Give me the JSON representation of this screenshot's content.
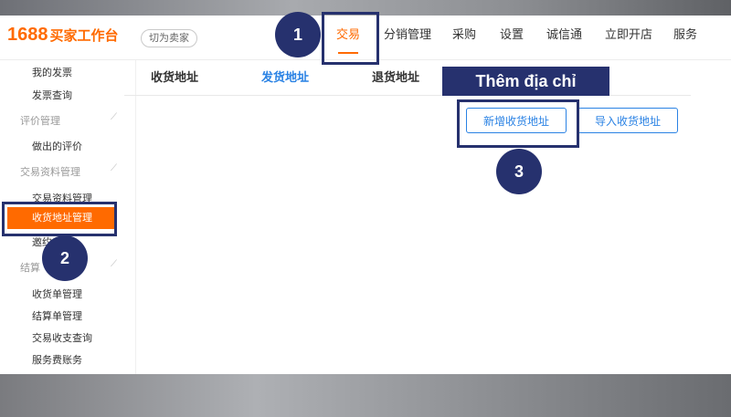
{
  "header": {
    "logo_number": "1688",
    "logo_text": "买家工作台",
    "switch_label": "切为卖家",
    "nav": [
      "交易",
      "分销管理",
      "采购",
      "设置",
      "诚信通",
      "立即开店",
      "服务"
    ],
    "active_nav_index": 0
  },
  "sidebar": {
    "items": [
      {
        "label": "我的发票",
        "type": "item"
      },
      {
        "label": "发票查询",
        "type": "item"
      },
      {
        "label": "评价管理",
        "type": "group"
      },
      {
        "label": "做出的评价",
        "type": "item"
      },
      {
        "label": "交易资料管理",
        "type": "group"
      },
      {
        "label": "交易资料管理",
        "type": "item"
      },
      {
        "label": "收货地址管理",
        "type": "active"
      },
      {
        "label": "邀约",
        "type": "item"
      },
      {
        "label": "结算",
        "type": "group"
      },
      {
        "label": "收货单管理",
        "type": "item"
      },
      {
        "label": "结算单管理",
        "type": "item"
      },
      {
        "label": "交易收支查询",
        "type": "item"
      },
      {
        "label": "服务费账务",
        "type": "item"
      }
    ]
  },
  "tabs": [
    {
      "label": "收货地址"
    },
    {
      "label": "发货地址"
    },
    {
      "label": "退货地址"
    }
  ],
  "actions": {
    "add_address": "新增收货地址",
    "import_address": "导入收货地址"
  },
  "annotations": {
    "callout_text": "Thêm địa chỉ",
    "steps": [
      "1",
      "2",
      "3"
    ]
  },
  "colors": {
    "brand": "#ff6a00",
    "link": "#2a82e4",
    "annotation": "#26316e"
  }
}
